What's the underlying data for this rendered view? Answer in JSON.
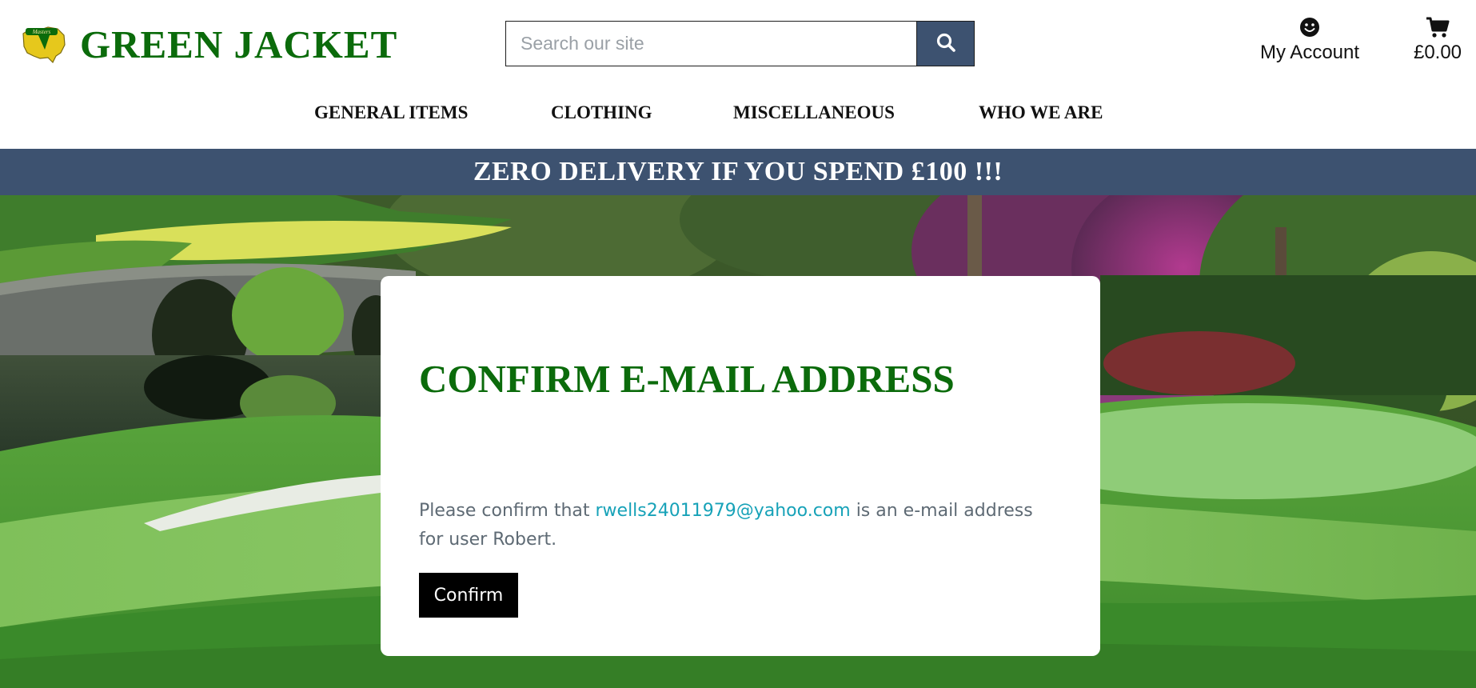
{
  "header": {
    "brand_name": "GREEN JACKET",
    "logo_badge_text": "Masters",
    "search": {
      "placeholder": "Search our site",
      "value": ""
    },
    "account_label": "My Account",
    "cart_total": "£0.00"
  },
  "nav": {
    "items": [
      {
        "label": "GENERAL ITEMS"
      },
      {
        "label": "CLOTHING"
      },
      {
        "label": "MISCELLANEOUS"
      },
      {
        "label": "WHO WE ARE"
      }
    ]
  },
  "banner": {
    "text": "ZERO DELIVERY IF YOU SPEND £100 !!!"
  },
  "card": {
    "title": "CONFIRM E-MAIL ADDRESS",
    "message_prefix": "Please confirm that ",
    "email": "rwells24011979@yahoo.com",
    "message_suffix": " is an e-mail address for user Robert.",
    "confirm_label": "Confirm"
  },
  "colors": {
    "brand_green": "#0b6b0b",
    "banner_navy": "#3d5270",
    "link_teal": "#17a2b8",
    "button_black": "#000000"
  },
  "icons": {
    "search": "search-icon",
    "account": "smiley-user-icon",
    "cart": "shopping-cart-icon",
    "logo": "masters-logo-badge"
  }
}
